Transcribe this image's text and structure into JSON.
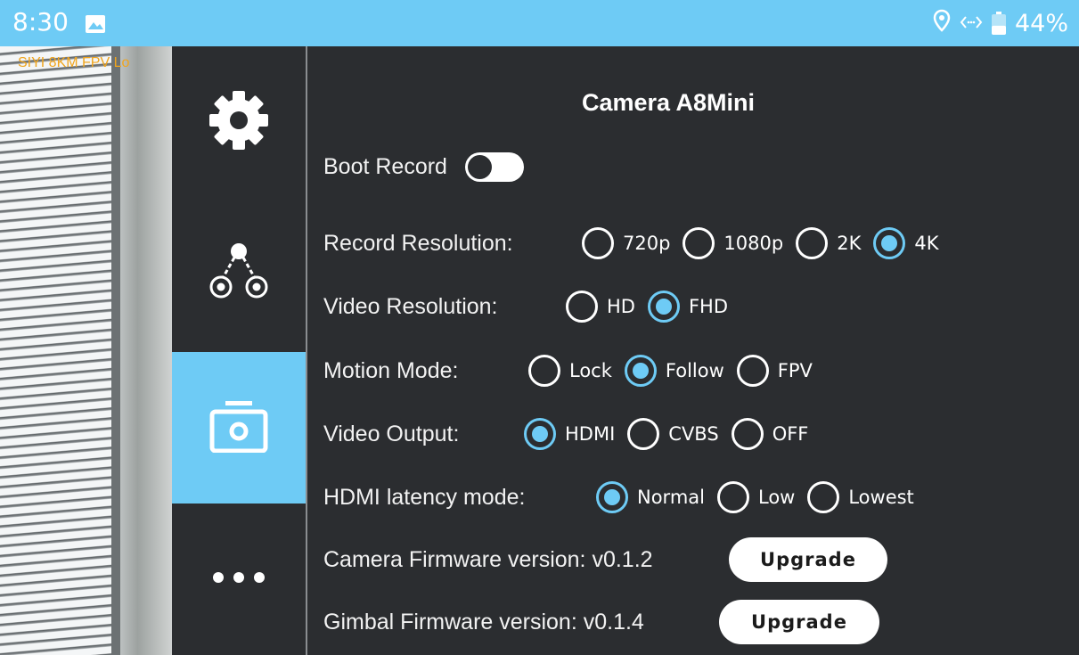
{
  "status_bar": {
    "time": "8:30",
    "image_icon": "image-icon",
    "location_icon": "location-icon",
    "code_icon": "code-icon",
    "battery_icon": "battery-icon",
    "battery_level": 0.44,
    "battery_text": "44%"
  },
  "feed": {
    "osd_text": "SIYI  8KM FPV Lo"
  },
  "sidemenu": {
    "items": [
      {
        "icon": "gear-icon",
        "active": false
      },
      {
        "icon": "gimbal-icon",
        "active": false
      },
      {
        "icon": "camera-icon",
        "active": true
      },
      {
        "icon": "more-icon",
        "active": false
      }
    ]
  },
  "content": {
    "title": "Camera A8Mini",
    "boot_record": {
      "label": "Boot Record",
      "on": false
    },
    "record_resolution": {
      "label": "Record Resolution:",
      "options": [
        "720p",
        "1080p",
        "2K",
        "4K"
      ],
      "selected": "4K"
    },
    "video_resolution": {
      "label": "Video Resolution:",
      "options": [
        "HD",
        "FHD"
      ],
      "selected": "FHD"
    },
    "motion_mode": {
      "label": "Motion Mode:",
      "options": [
        "Lock",
        "Follow",
        "FPV"
      ],
      "selected": "Follow"
    },
    "video_output": {
      "label": "Video Output:",
      "options": [
        "HDMI",
        "CVBS",
        "OFF"
      ],
      "selected": "HDMI"
    },
    "hdmi_latency": {
      "label": "HDMI latency mode:",
      "options": [
        "Normal",
        "Low",
        "Lowest"
      ],
      "selected": "Normal"
    },
    "camera_firmware": {
      "label": "Camera Firmware version: v0.1.2",
      "button": "Upgrade"
    },
    "gimbal_firmware": {
      "label": "Gimbal Firmware version: v0.1.4",
      "button": "Upgrade"
    }
  },
  "colors": {
    "accent": "#6ecbf5",
    "background": "#2b2d30",
    "osd": "#f0a51e"
  }
}
